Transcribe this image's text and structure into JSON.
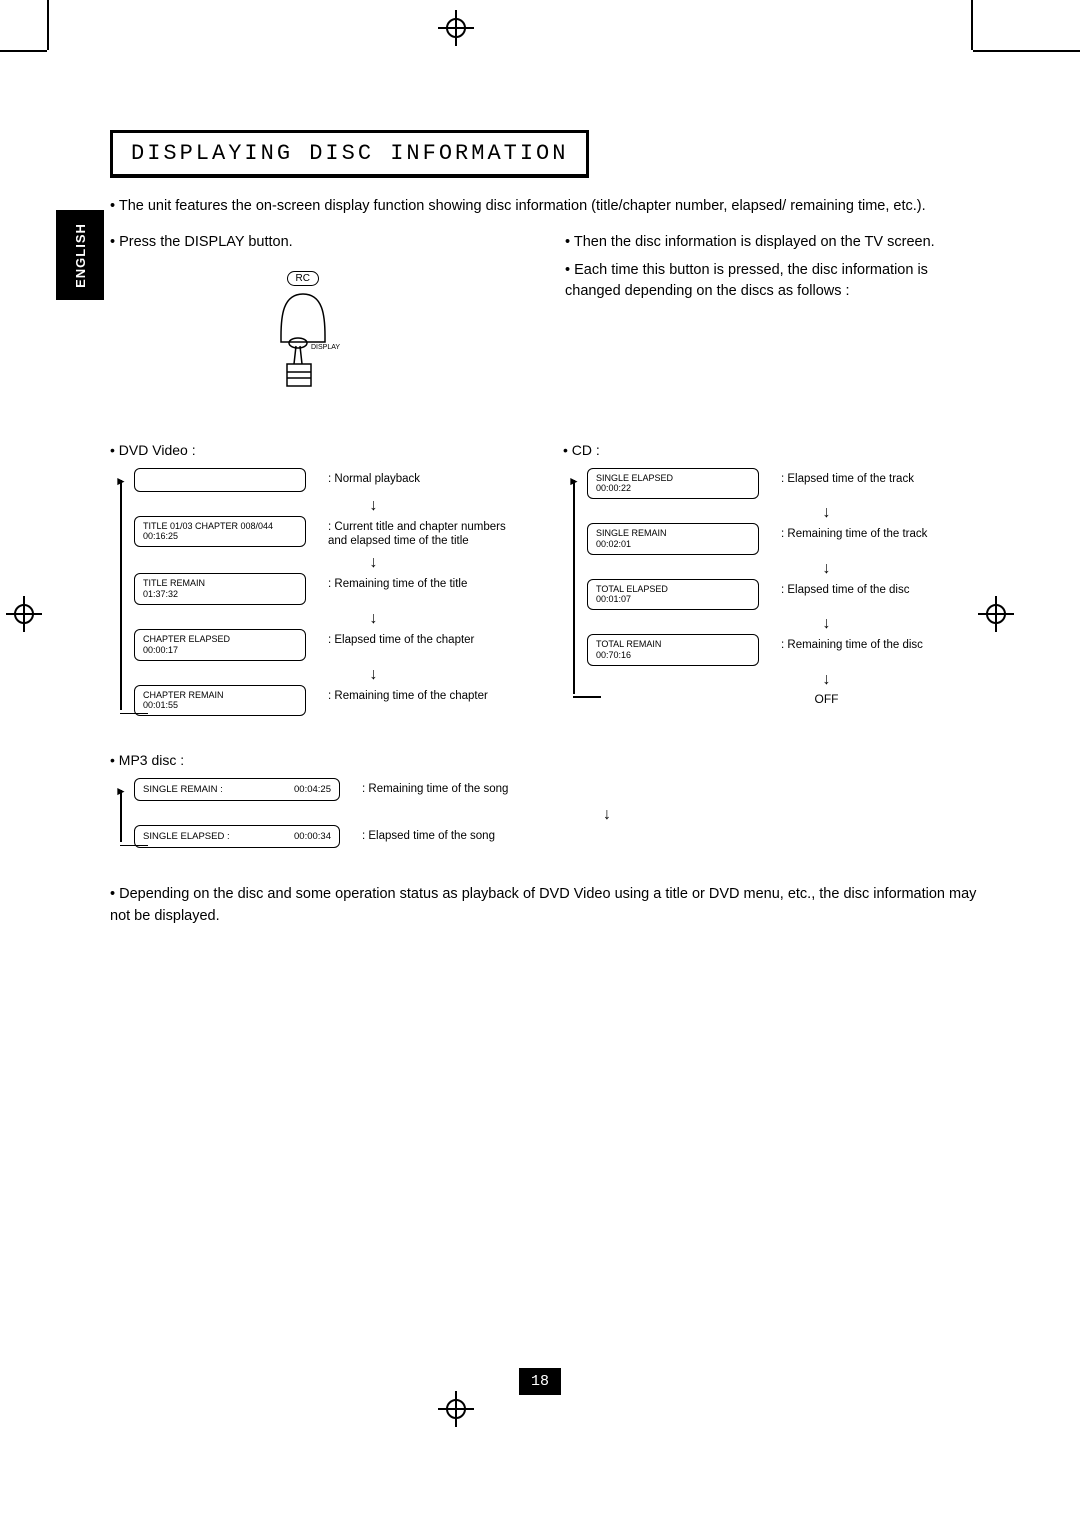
{
  "language_tab": "ENGLISH",
  "section_title": "DISPLAYING DISC INFORMATION",
  "intro": "The unit features the on-screen display function showing disc information (title/chapter number, elapsed/ remaining time, etc.).",
  "left_bullet": "Press the DISPLAY button.",
  "rc_label": "RC",
  "display_btn_label": "DISPLAY",
  "right_bullets": [
    "Then the disc information is displayed on the TV screen.",
    "Each time this button is pressed, the disc information is changed depending on the discs as follows :"
  ],
  "dvd_label": "DVD Video :",
  "cd_label": "CD :",
  "mp3_label": "MP3 disc :",
  "dvd": [
    {
      "line1": "",
      "line2": "",
      "desc": "Normal playback",
      "blank": true
    },
    {
      "line1": "TITLE 01/03 CHAPTER 008/044",
      "line2": "00:16:25",
      "desc": "Current title and chapter numbers and elapsed time of the title"
    },
    {
      "line1": "TITLE REMAIN",
      "line2": "01:37:32",
      "desc": "Remaining time of the title"
    },
    {
      "line1": "CHAPTER ELAPSED",
      "line2": "00:00:17",
      "desc": "Elapsed time of the chapter"
    },
    {
      "line1": "CHAPTER REMAIN",
      "line2": "00:01:55",
      "desc": "Remaining time of the chapter"
    }
  ],
  "cd": [
    {
      "line1": "SINGLE ELAPSED",
      "line2": "00:00:22",
      "desc": "Elapsed time of the track"
    },
    {
      "line1": "SINGLE REMAIN",
      "line2": "00:02:01",
      "desc": "Remaining time of the track"
    },
    {
      "line1": "TOTAL ELAPSED",
      "line2": "00:01:07",
      "desc": "Elapsed time of the disc"
    },
    {
      "line1": "TOTAL REMAIN",
      "line2": "00:70:16",
      "desc": "Remaining time of the disc"
    }
  ],
  "cd_off": "OFF",
  "mp3": [
    {
      "label": "SINGLE REMAIN :",
      "time": "00:04:25",
      "desc": "Remaining time of the song"
    },
    {
      "label": "SINGLE ELAPSED :",
      "time": "00:00:34",
      "desc": "Elapsed time of the song"
    }
  ],
  "footnote": "Depending on the disc and some operation status as playback of DVD Video using a title or DVD menu, etc., the disc information may not be displayed.",
  "page_number": "18"
}
